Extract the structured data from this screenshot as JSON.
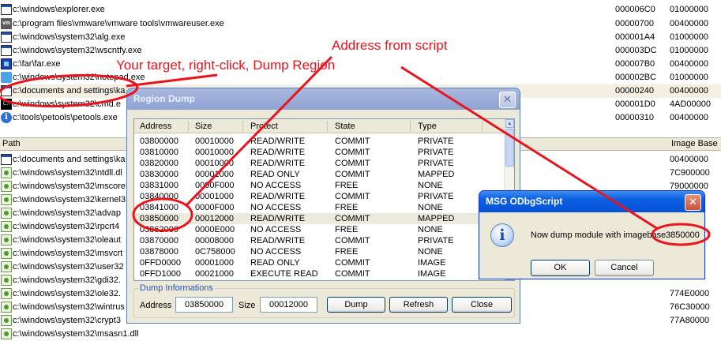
{
  "process_list": {
    "rows": [
      {
        "icon": "window-icon",
        "path": "c:\\windows\\explorer.exe",
        "pid": "000006C0",
        "base": "01000000"
      },
      {
        "icon": "vmware-icon",
        "path": "c:\\program files\\vmware\\vmware tools\\vmwareuser.exe",
        "pid": "00000700",
        "base": "00400000"
      },
      {
        "icon": "window-icon",
        "path": "c:\\windows\\system32\\alg.exe",
        "pid": "000001A4",
        "base": "01000000"
      },
      {
        "icon": "window-icon",
        "path": "c:\\windows\\system32\\wscntfy.exe",
        "pid": "000003DC",
        "base": "01000000"
      },
      {
        "icon": "far-manager-icon",
        "path": "c:\\far\\far.exe",
        "pid": "000007B0",
        "base": "00400000"
      },
      {
        "icon": "notepad-icon",
        "path": "c:\\windows\\system32\\notepad.exe",
        "pid": "000002BC",
        "base": "01000000"
      },
      {
        "icon": "window-icon",
        "path": "c:\\documents and settings\\ka",
        "pid": "00000240",
        "base": "00400000"
      },
      {
        "icon": "console-icon",
        "path": "c:\\windows\\system32\\cmd.e",
        "pid": "000001D0",
        "base": "4AD00000"
      },
      {
        "icon": "info-icon",
        "path": "c:\\tools\\petools\\petools.exe",
        "pid": "00000310",
        "base": "00400000"
      }
    ]
  },
  "modules": {
    "header": {
      "path": "Path",
      "image_base": "Image Base"
    },
    "rows": [
      {
        "icon": "window-icon",
        "path": "c:\\documents and settings\\ka",
        "base": "00400000"
      },
      {
        "icon": "dll-icon",
        "path": "c:\\windows\\system32\\ntdll.dl",
        "base": "7C900000"
      },
      {
        "icon": "dll-icon",
        "path": "c:\\windows\\system32\\mscore",
        "base": "79000000"
      },
      {
        "icon": "dll-icon",
        "path": "c:\\windows\\system32\\kernel3",
        "base": ""
      },
      {
        "icon": "dll-icon",
        "path": "c:\\windows\\system32\\advap",
        "base": ""
      },
      {
        "icon": "dll-icon",
        "path": "c:\\windows\\system32\\rpcrt4",
        "base": ""
      },
      {
        "icon": "dll-icon",
        "path": "c:\\windows\\system32\\oleaut",
        "base": ""
      },
      {
        "icon": "dll-icon",
        "path": "c:\\windows\\system32\\msvcrt",
        "base": ""
      },
      {
        "icon": "dll-icon",
        "path": "c:\\windows\\system32\\user32",
        "base": ""
      },
      {
        "icon": "dll-icon",
        "path": "c:\\windows\\system32\\gdi32.",
        "base": ""
      },
      {
        "icon": "dll-icon",
        "path": "c:\\windows\\system32\\ole32.",
        "base": "774E0000"
      },
      {
        "icon": "dll-icon",
        "path": "c:\\windows\\system32\\wintrus",
        "base": "76C30000"
      },
      {
        "icon": "dll-icon",
        "path": "c:\\windows\\system32\\crypt3",
        "base": "77A80000"
      },
      {
        "icon": "dll-icon",
        "path": "c:\\windows\\system32\\msasn1.dll",
        "base": ""
      }
    ]
  },
  "region_dump": {
    "title": "Region Dump",
    "columns": [
      "Address",
      "Size",
      "Protect",
      "State",
      "Type"
    ],
    "rows": [
      [
        "03800000",
        "00010000",
        "READ/WRITE",
        "COMMIT",
        "PRIVATE"
      ],
      [
        "03810000",
        "00010000",
        "READ/WRITE",
        "COMMIT",
        "PRIVATE"
      ],
      [
        "03820000",
        "00010000",
        "READ/WRITE",
        "COMMIT",
        "PRIVATE"
      ],
      [
        "03830000",
        "00001000",
        "READ ONLY",
        "COMMIT",
        "MAPPED"
      ],
      [
        "03831000",
        "0000F000",
        "NO ACCESS",
        "FREE",
        "NONE"
      ],
      [
        "03840000",
        "00001000",
        "READ/WRITE",
        "COMMIT",
        "PRIVATE"
      ],
      [
        "03841000",
        "0000F000",
        "NO ACCESS",
        "FREE",
        "NONE"
      ],
      [
        "03850000",
        "00012000",
        "READ/WRITE",
        "COMMIT",
        "MAPPED"
      ],
      [
        "03862000",
        "0000E000",
        "NO ACCESS",
        "FREE",
        "NONE"
      ],
      [
        "03870000",
        "00008000",
        "READ/WRITE",
        "COMMIT",
        "PRIVATE"
      ],
      [
        "03878000",
        "0C758000",
        "NO ACCESS",
        "FREE",
        "NONE"
      ],
      [
        "0FFD0000",
        "00001000",
        "READ ONLY",
        "COMMIT",
        "IMAGE"
      ],
      [
        "0FFD1000",
        "00021000",
        "EXECUTE READ",
        "COMMIT",
        "IMAGE"
      ]
    ],
    "dump_info": {
      "label": "Dump Informations",
      "address_label": "Address",
      "address_value": "03850000",
      "size_label": "Size",
      "size_value": "00012000"
    },
    "buttons": {
      "dump": "Dump",
      "refresh": "Refresh",
      "close": "Close"
    }
  },
  "message_box": {
    "title": "MSG ODbgScript",
    "text": "Now dump module with imagebase",
    "value": "3850000",
    "ok": "OK",
    "cancel": "Cancel"
  },
  "annotations": {
    "address_from_script": "Address from script",
    "your_target": "Your target, right-click, Dump Region",
    "color": "#e8141e"
  },
  "colors": {
    "xp_title_active": "#0652d6",
    "xp_title_inactive": "#8fa3d2",
    "dialog_face": "#ece9d8",
    "selected_row": "#f3efe2",
    "group_label": "#2552c0"
  }
}
